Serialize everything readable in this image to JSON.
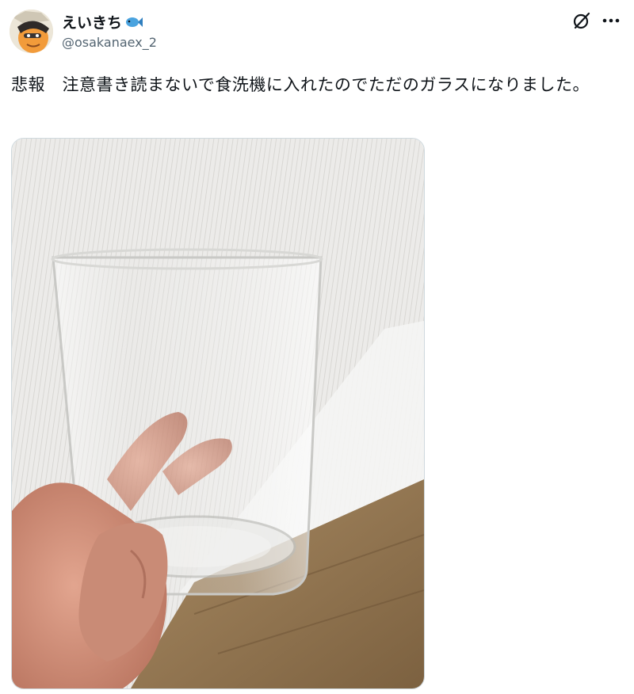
{
  "author": {
    "display_name": "えいきち",
    "badge_emoji": "🐟",
    "handle": "@osakanaex_2"
  },
  "post": {
    "text": "悲報　注意書き読まないで食洗機に入れたのでただのガラスになりました。"
  },
  "media": {
    "icon": "photo-glass-cup"
  },
  "icons": {
    "grok": "grok-icon",
    "more": "more-icon"
  }
}
